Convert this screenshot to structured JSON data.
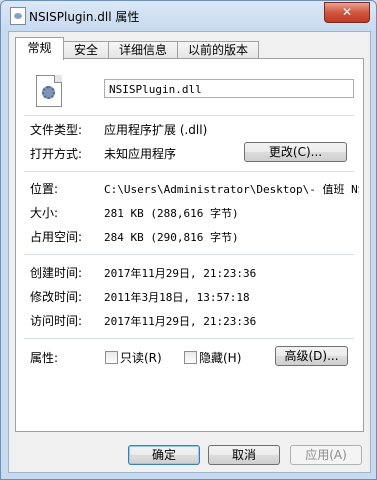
{
  "window": {
    "title": "NSISPlugin.dll 属性",
    "close_glyph": "✕",
    "icon": "dll-file-icon"
  },
  "tabs": [
    {
      "label": "常规",
      "active": true
    },
    {
      "label": "安全",
      "active": false
    },
    {
      "label": "详细信息",
      "active": false
    },
    {
      "label": "以前的版本",
      "active": false
    }
  ],
  "general": {
    "file_icon": "dll-settings-icon",
    "filename": "NSISPlugin.dll",
    "file_type_label": "文件类型:",
    "file_type_value": "应用程序扩展 (.dll)",
    "opens_with_label": "打开方式:",
    "opens_with_value": "未知应用程序",
    "change_button": "更改(C)...",
    "location_label": "位置:",
    "location_value": "C:\\Users\\Administrator\\Desktop\\- 值班 NS",
    "size_label": "大小:",
    "size_value": "281 KB (288,616 字节)",
    "size_on_disk_label": "占用空间:",
    "size_on_disk_value": "284 KB (290,816 字节)",
    "created_label": "创建时间:",
    "created_value": "2017年11月29日, 21:23:36",
    "modified_label": "修改时间:",
    "modified_value": "2011年3月18日, 13:57:18",
    "accessed_label": "访问时间:",
    "accessed_value": "2017年11月29日, 21:23:36",
    "attributes_label": "属性:",
    "readonly_label": "只读(R)",
    "readonly_checked": false,
    "hidden_label": "隐藏(H)",
    "hidden_checked": false,
    "advanced_button": "高级(D)..."
  },
  "footer": {
    "ok": "确定",
    "cancel": "取消",
    "apply": "应用(A)"
  }
}
